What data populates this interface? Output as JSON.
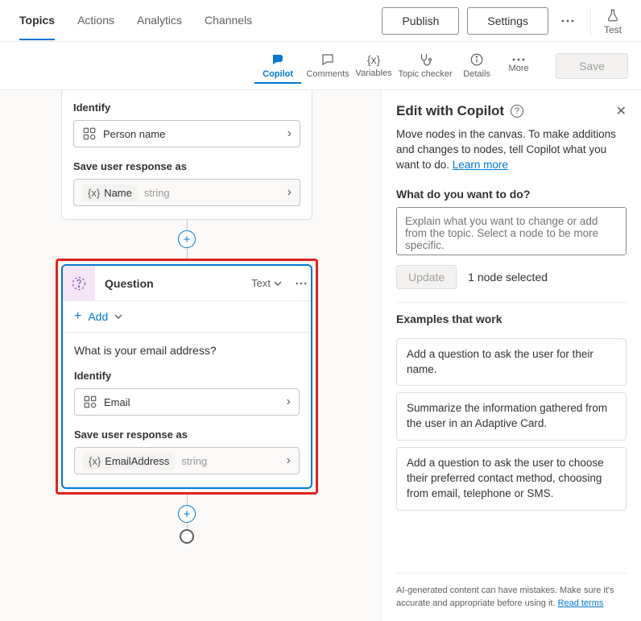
{
  "topnav": {
    "tabs": {
      "topics": "Topics",
      "actions": "Actions",
      "analytics": "Analytics",
      "channels": "Channels"
    },
    "publish": "Publish",
    "settings": "Settings",
    "test": "Test"
  },
  "toolbar": {
    "copilot": "Copilot",
    "comments": "Comments",
    "variables": "Variables",
    "topic_checker": "Topic checker",
    "details": "Details",
    "more": "More",
    "save": "Save"
  },
  "canvas": {
    "node1": {
      "identify_label": "Identify",
      "identify_value": "Person name",
      "save_label": "Save user response as",
      "var_name": "Name",
      "var_type": "string"
    },
    "node2": {
      "title": "Question",
      "mode": "Text",
      "add": "Add",
      "body_text": "What is your email address?",
      "identify_label": "Identify",
      "identify_value": "Email",
      "save_label": "Save user response as",
      "var_name": "EmailAddress",
      "var_type": "string"
    }
  },
  "panel": {
    "title": "Edit with Copilot",
    "intro_pre": "Move nodes in the canvas. To make additions and changes to nodes, tell Copilot what you want to do. ",
    "learn_more": "Learn more",
    "q_heading": "What do you want to do?",
    "placeholder": "Explain what you want to change or add from the topic. Select a node to be more specific.",
    "update": "Update",
    "selected": "1 node selected",
    "examples_heading": "Examples that work",
    "examples": {
      "e1": "Add a question to ask the user for their name.",
      "e2": "Summarize the information gathered from the user in an Adaptive Card.",
      "e3": "Add a question to ask the user to choose their preferred contact method, choosing from email, telephone or SMS."
    },
    "disclaimer_text": "AI-generated content can have mistakes. Make sure it's accurate and appropriate before using it. ",
    "read_terms": "Read terms"
  }
}
